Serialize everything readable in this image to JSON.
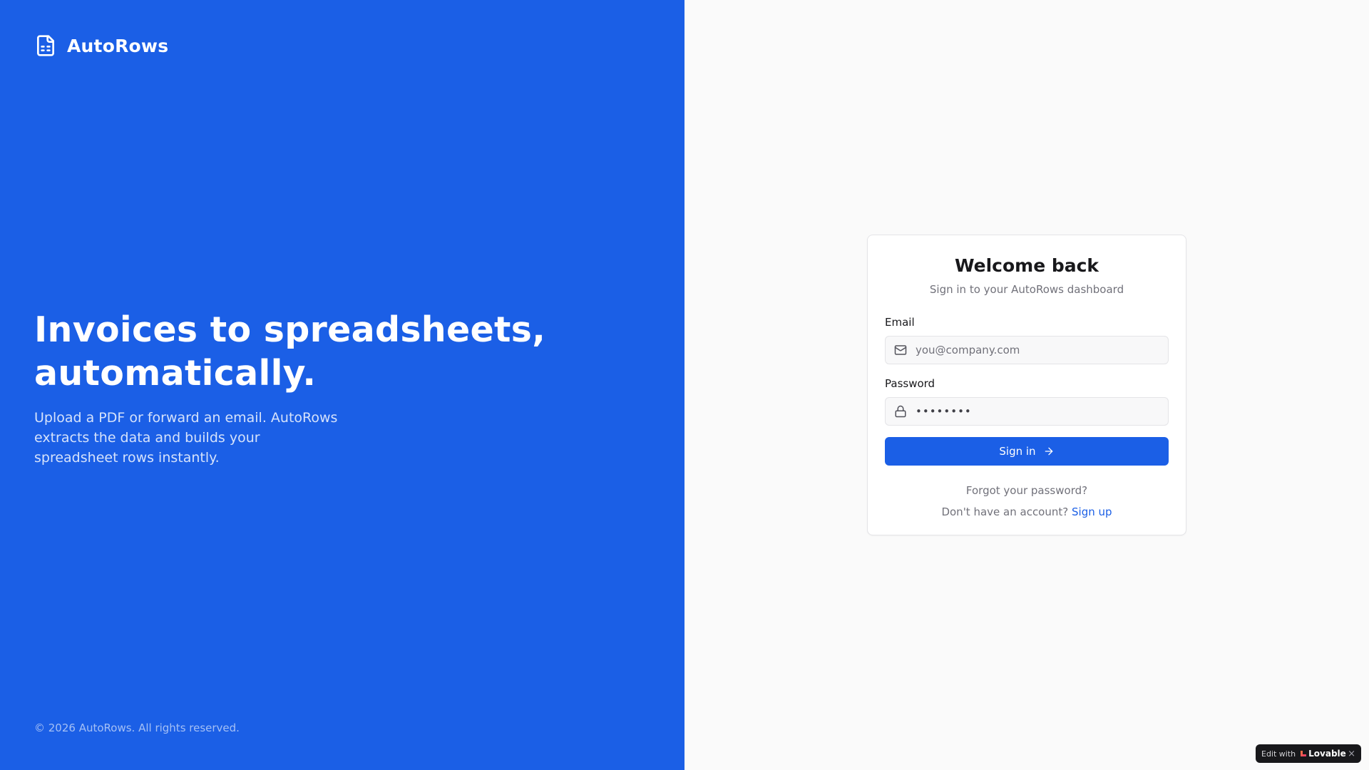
{
  "brand": {
    "name": "AutoRows",
    "icon": "file-spreadsheet-icon"
  },
  "hero": {
    "title_line1": "Invoices to spreadsheets,",
    "title_line2": "automatically.",
    "subtitle": "Upload a PDF or forward an email. AutoRows extracts the data and builds your spreadsheet rows instantly."
  },
  "footer": {
    "copyright": "© 2026 AutoRows. All rights reserved."
  },
  "login": {
    "title": "Welcome back",
    "subtitle": "Sign in to your AutoRows dashboard",
    "email_label": "Email",
    "email_placeholder": "you@company.com",
    "email_value": "",
    "password_label": "Password",
    "password_value": "••••••••",
    "signin_label": "Sign in",
    "forgot_label": "Forgot your password?",
    "signup_prompt": "Don't have an account?",
    "signup_label": "Sign up"
  },
  "badge": {
    "prefix": "Edit with",
    "logo_text": "Lovable",
    "close": "×"
  },
  "colors": {
    "accent": "#1b5fe6",
    "panel_bg": "#fafafa",
    "text_dark": "#18181b",
    "text_muted": "#71717a"
  }
}
